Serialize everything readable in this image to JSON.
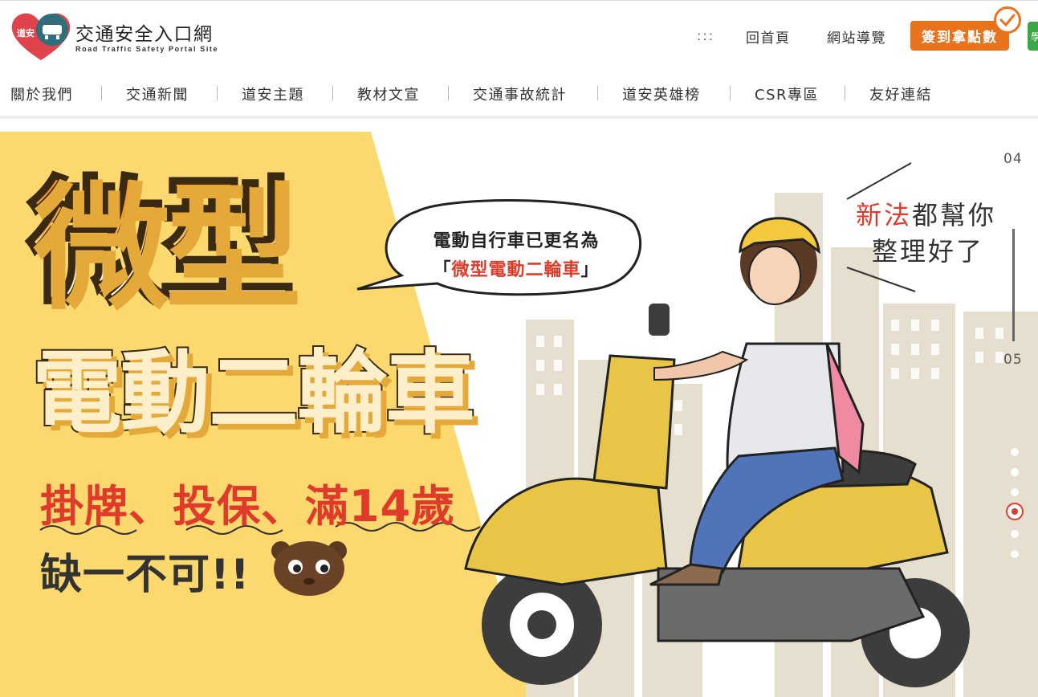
{
  "header": {
    "logo_text": "交通安全入口網",
    "logo_subtitle": "Road Traffic Safety Portal Site",
    "accesskey": ":::",
    "home_link": "回首頁",
    "sitemap_link": "網站導覽",
    "checkin_button": "簽到拿點數",
    "green_button": "學"
  },
  "nav": {
    "items": [
      "關於我們",
      "交通新聞",
      "道安主題",
      "教材文宣",
      "交通事故統計",
      "道安英雄榜",
      "CSR專區",
      "友好連結"
    ]
  },
  "banner": {
    "headline_1": "微型",
    "headline_2": "電動二輪車",
    "requirements": "掛牌、投保、滿14歲",
    "tagline": "缺一不可!!",
    "bubble_line1": "電動自行車已更名為",
    "bubble_open": "「",
    "bubble_highlight": "微型電動二輪車",
    "bubble_close": "」",
    "note_red": "新法",
    "note_rest": "都幫你",
    "note_line2": "整理好了",
    "slide_current": "04",
    "slide_next": "05"
  },
  "colors": {
    "accent_orange": "#e8731c",
    "banner_yellow": "#fcd96f",
    "headline_red": "#e03a2b",
    "green": "#3aa845"
  }
}
